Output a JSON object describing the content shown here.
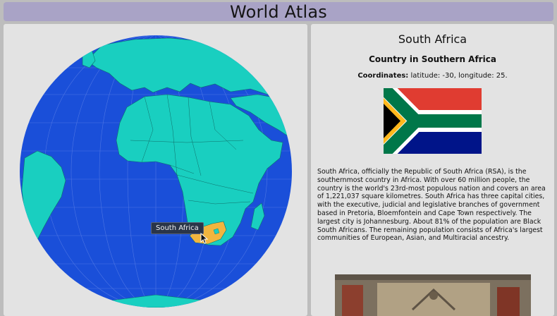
{
  "header": {
    "title": "World Atlas"
  },
  "globe": {
    "tooltip": "South Africa",
    "colors": {
      "ocean": "#1a4fd9",
      "land": "#19cfc0",
      "selected": "#f1b53e",
      "graticule": "#5a7fe6"
    }
  },
  "info": {
    "country_name": "South Africa",
    "subtitle": "Country in Southern Africa",
    "coords_label": "Coordinates:",
    "coords_value": " latitude: -30, longitude: 25.",
    "description": "South Africa, officially the Republic of South Africa (RSA), is the southernmost country in Africa. With over 60 million people, the country is the world's 23rd-most populous nation and covers an area of 1,221,037 square kilometres. South Africa has three capital cities, with the executive, judicial and legislative branches of government based in Pretoria, Bloemfontein and Cape Town respectively. The largest city is Johannesburg. About 81% of the population are Black South Africans. The remaining population consists of Africa's largest communities of European, Asian, and Multiracial ancestry."
  }
}
